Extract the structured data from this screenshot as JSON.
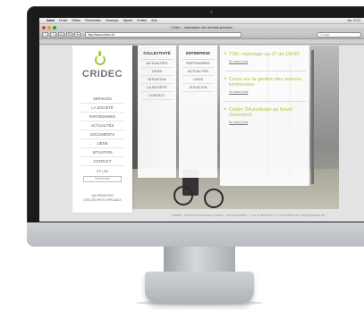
{
  "menubar": {
    "items": [
      "Safari",
      "Fichier",
      "Édition",
      "Présentation",
      "Historique",
      "Signets",
      "Fenêtre",
      "Aide"
    ],
    "clock": "Jeu. 17:21"
  },
  "window": {
    "title": "Cridec – Valorisation des déchets spéciaux"
  },
  "toolbar": {
    "url": "http://www.cridec.ch",
    "search_placeholder": "Google"
  },
  "site": {
    "logo": "CRIDEC",
    "nav": [
      "SERVICES",
      "LA SOCIÉTÉ",
      "PARTENAIRES",
      "ACTUALITÉS",
      "DOCUMENTS",
      "LIENS",
      "SITUATION",
      "CONTACT"
    ],
    "lang": "FR | DE",
    "search_label": "Recherche",
    "tagline_1": "VALORISATION",
    "tagline_2": "DES DÉCHETS SPÉCIAUX",
    "footer": "CRIDEC · ROUTE DU BOIS-DE-LA-CROIX · 1307 ECLÉPENS · T +41 21 866 04 00 · F +41 21 866 04 09 · INFO@CRIDEC.CH"
  },
  "menus": {
    "collectivite": {
      "title": "COLLECTIVITÉ",
      "items": [
        "ACTUALITÉS",
        "LIENS",
        "SITUATION",
        "LA SOCIÉTÉ",
        "CONTACT"
      ]
    },
    "entreprise": {
      "title": "ENTREPRISE",
      "items": [
        "PARTENAIRES",
        "ACTUALITÉS",
        "LIENS",
        "SITUATION"
      ]
    }
  },
  "news": [
    {
      "title": "TSR, reportage au JT de 19h30",
      "more": "En savoir plus"
    },
    {
      "title": "Cours sur la gestion des sources lumineuses",
      "more": "En savoir plus"
    },
    {
      "title": "Cridec SA participe au forum Greentech",
      "more": "En savoir plus"
    }
  ],
  "colors": {
    "accent": "#a0c93c",
    "bezel": "#1b1b1c"
  }
}
